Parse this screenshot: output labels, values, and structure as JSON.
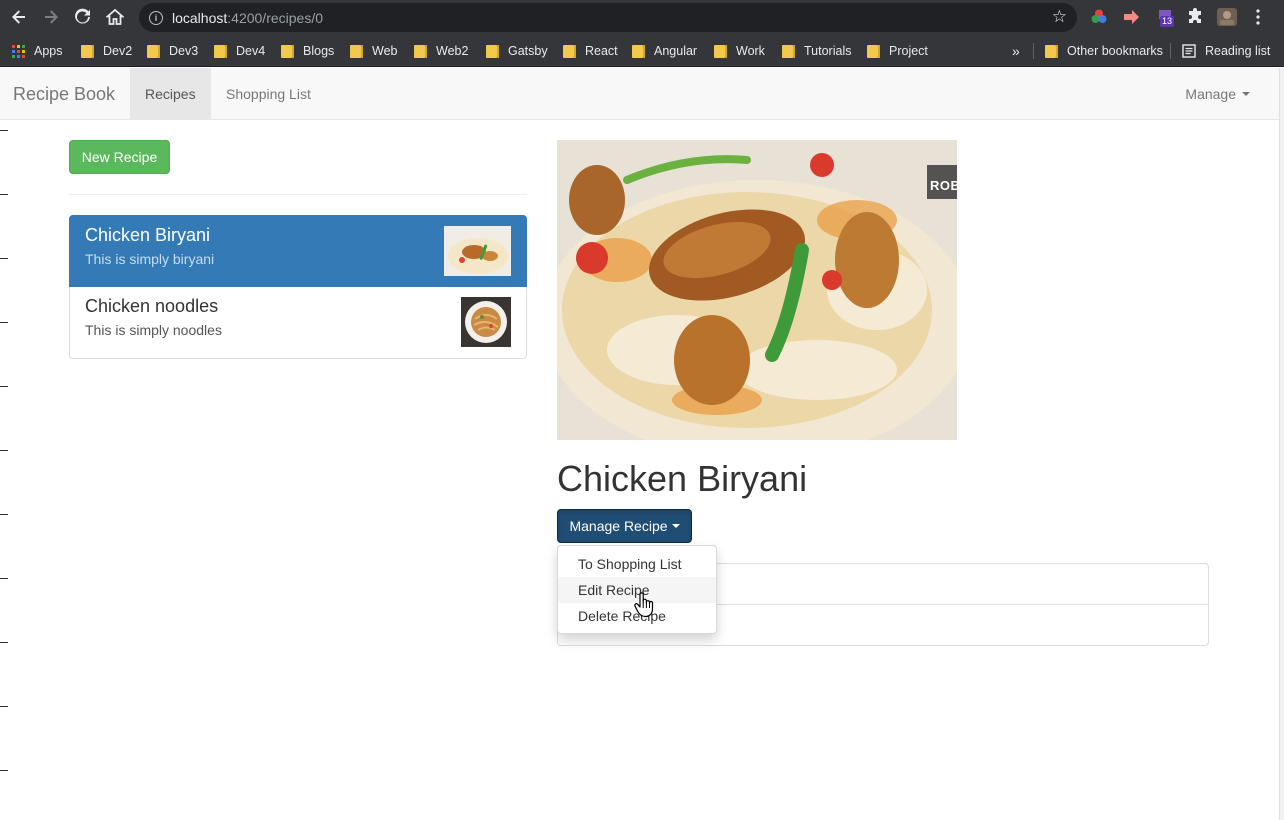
{
  "browser": {
    "url_host": "localhost",
    "url_path": ":4200/recipes/0",
    "extension_badge": "13",
    "bookmarks": [
      {
        "label": "Apps",
        "type": "apps"
      },
      {
        "label": "Dev2",
        "type": "folder"
      },
      {
        "label": "Dev3",
        "type": "folder"
      },
      {
        "label": "Dev4",
        "type": "folder"
      },
      {
        "label": "Blogs",
        "type": "folder"
      },
      {
        "label": "Web",
        "type": "folder"
      },
      {
        "label": "Web2",
        "type": "folder"
      },
      {
        "label": "Gatsby",
        "type": "folder"
      },
      {
        "label": "React",
        "type": "folder"
      },
      {
        "label": "Angular",
        "type": "folder"
      },
      {
        "label": "Work",
        "type": "folder"
      },
      {
        "label": "Tutorials",
        "type": "folder"
      },
      {
        "label": "Project",
        "type": "folder"
      }
    ],
    "overflow_label": "»",
    "other_bookmarks": "Other bookmarks",
    "reading_list": "Reading list"
  },
  "navbar": {
    "brand": "Recipe Book",
    "tabs": [
      {
        "label": "Recipes",
        "active": true
      },
      {
        "label": "Shopping List",
        "active": false
      }
    ],
    "manage": "Manage"
  },
  "recipes": {
    "new_button": "New Recipe",
    "items": [
      {
        "name": "Chicken Biryani",
        "description": "This is simply biryani",
        "active": true
      },
      {
        "name": "Chicken noodles",
        "description": "This is simply noodles",
        "active": false
      }
    ]
  },
  "detail": {
    "title": "Chicken Biryani",
    "manage_button": "Manage Recipe",
    "image_watermark": "ROB",
    "dropdown": [
      {
        "label": "To Shopping List",
        "hover": false
      },
      {
        "label": "Edit Recipe",
        "hover": true
      },
      {
        "label": "Delete Recipe",
        "hover": false
      }
    ]
  },
  "colors": {
    "primary": "#337ab7",
    "success": "#5cb85c",
    "manage_active": "#204d74",
    "chrome": "#35363a"
  }
}
